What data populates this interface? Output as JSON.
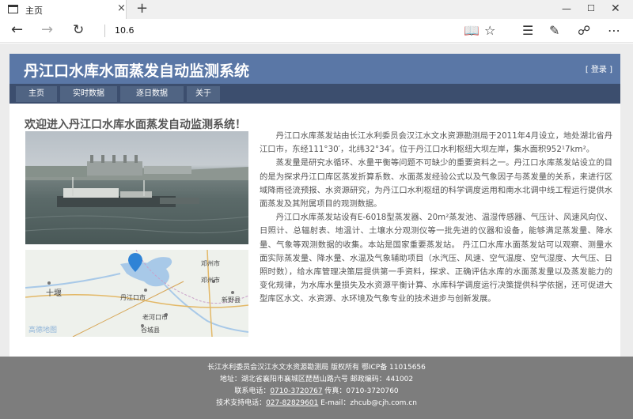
{
  "browser": {
    "tab_title": "主页",
    "tab_close": "×",
    "new_tab": "+",
    "url": "10.6",
    "window_controls": {
      "minimize": "—",
      "maximize": "☐",
      "close": "✕"
    },
    "icons": [
      "page-icon",
      "back-icon",
      "forward-icon",
      "refresh-icon",
      "reading-view-icon",
      "favorite-star-icon",
      "hub-icon",
      "web-note-icon",
      "share-icon",
      "more-icon"
    ]
  },
  "site": {
    "title": "丹江口水库水面蒸发自动监测系统",
    "login": "[ 登录 ]",
    "nav": [
      "主页",
      "实时数据",
      "逐日数据",
      "关于"
    ],
    "welcome": "欢迎进入丹江口水库水面蒸发自动监测系统！",
    "header_color": "#5a77a6",
    "nav_color": "#3c4e6e",
    "map_labels": {
      "zhengzhou": "邓州市",
      "dengzhou": "邓州市",
      "shiyan": "十堰",
      "danjiangkou": "丹江口市",
      "xinye": "新野县",
      "laohekou": "老河口市",
      "gucheng": "谷城县",
      "brand": "高德地图"
    },
    "article": [
      "丹江口水库蒸发站由长江水利委员会汉江水文水资源勘测局于2011年4月设立，地处湖北省丹江口市，东经111°30′，北纬32°34′。位于丹江口水利枢纽大坝左岸，集水面积952¹7km²。",
      "蒸发量是研究水循环、水量平衡等问题不可缺少的重要资料之一。丹江口水库蒸发站设立的目的是为探求丹江口库区蒸发折算系数、水面蒸发经验公式以及气象因子与蒸发量的关系，来进行区域降雨径流预报、水资源研究，为丹江口水利枢纽的科学调度运用和南水北调中线工程运行提供水面蒸发及其附属项目的观测数据。",
      "丹江口水库蒸发站设有E-6018型蒸发器、20m²蒸发池、温湿传感器、气压计、风速风向仪、日照计、总辐射表、地温计、土壤水分观测仪等一批先进的仪器和设备，能够满足蒸发量、降水量、气象等观测数据的收集。本站是国家重要蒸发站。 丹江口水库水面蒸发站可以观察、测量水面实际蒸发量、降水量、水温及气象辅助项目（水汽压、风速、空气温度、空气湿度、大气压、日照时数），给水库管理决策层提供第一手资料，探求、正确评估水库的水面蒸发量以及蒸发能力的变化规律，为水库水量损失及水资源平衡计算、水库科学调度运行决策提供科学依据，还可促进大型库区水文、水资源、水环境及气象专业的技术进步与创新发展。"
    ],
    "footer": {
      "line1": "长江水利委员会汉江水文水资源勘测局 版权所有 鄂ICP备 11015656",
      "line2": "地址：湖北省襄阳市襄城区琵琶山路六号 邮政编码：441002",
      "line3_label": "联系电话：",
      "line3_phone": "0710-3720767",
      "line3_fax": " 传真：0710-3720760",
      "line4_label": "技术支持电话：",
      "line4_phone": "027-82829601",
      "line4_email": " E-mail：zhcub@cjh.com.cn"
    }
  }
}
